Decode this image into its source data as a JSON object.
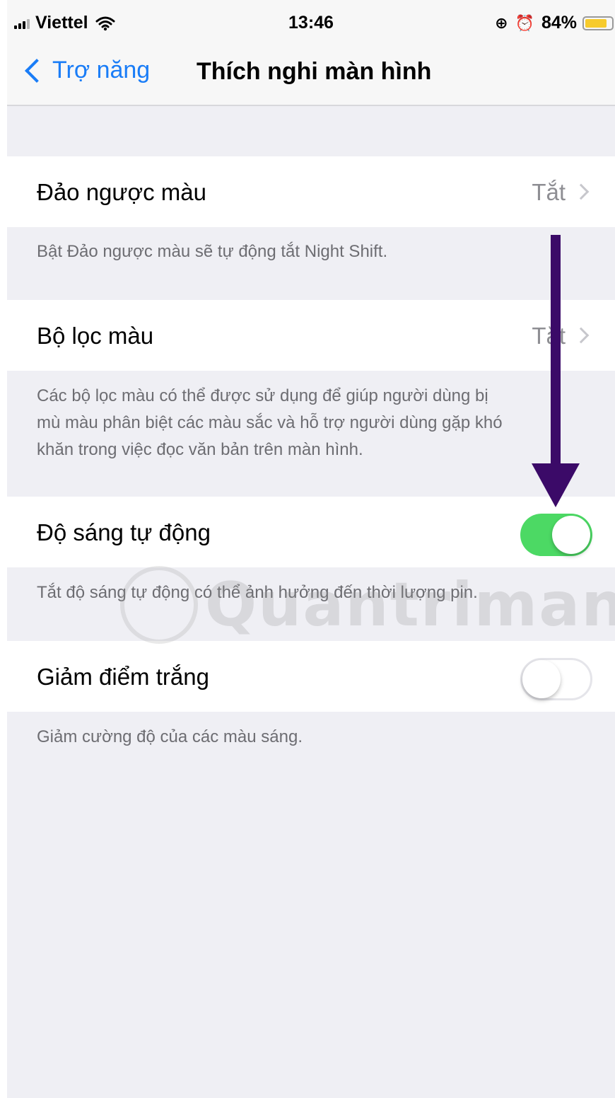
{
  "status_bar": {
    "carrier": "Viettel",
    "time": "13:46",
    "battery_percent": "84%",
    "battery_level": 0.84,
    "icons": [
      "signal-icon",
      "wifi-icon",
      "orientation-lock-icon",
      "alarm-icon",
      "battery-icon"
    ]
  },
  "nav": {
    "back_label": "Trợ năng",
    "title": "Thích nghi màn hình"
  },
  "settings": {
    "invert_colors": {
      "label": "Đảo ngược màu",
      "value": "Tắt",
      "footer": "Bật Đảo ngược màu sẽ tự động tắt Night Shift."
    },
    "color_filters": {
      "label": "Bộ lọc màu",
      "value": "Tắt",
      "footer_lines": [
        "Các bộ lọc màu có thể được sử dụng để giúp người dùng bị",
        "mù màu phân biệt các màu sắc và hỗ trợ người dùng gặp khó",
        "khăn trong việc đọc văn bản trên màn hình."
      ]
    },
    "auto_brightness": {
      "label": "Độ sáng tự động",
      "toggle_on": true,
      "footer": "Tắt độ sáng tự động có thể ảnh hưởng đến thời lượng pin."
    },
    "reduce_white_point": {
      "label": "Giảm điểm trắng",
      "toggle_on": false,
      "footer": "Giảm cường độ của các màu sáng."
    }
  },
  "watermark": {
    "text": "Quantrimang"
  },
  "colors": {
    "accent": "#1a7df7",
    "toggle_on": "#4cd964",
    "annotation_arrow": "#3b0a68",
    "background": "#efeff4",
    "battery": "#f7cb2c"
  }
}
